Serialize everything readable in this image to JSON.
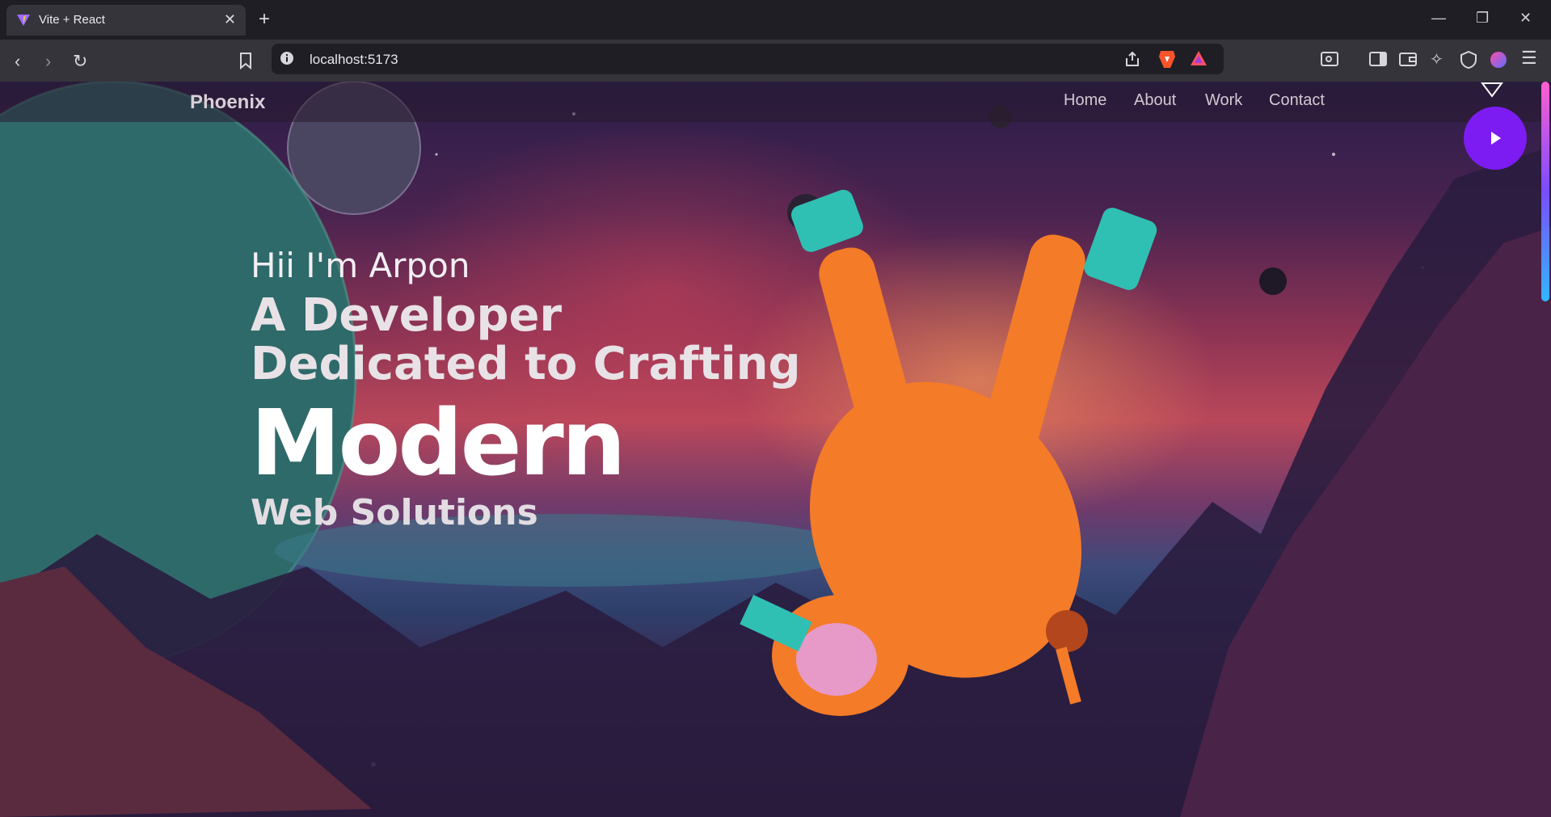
{
  "browser": {
    "tab_title": "Vite + React",
    "url": "localhost:5173"
  },
  "site": {
    "brand": "Phoenix",
    "nav": [
      {
        "label": "Home"
      },
      {
        "label": "About"
      },
      {
        "label": "Work"
      },
      {
        "label": "Contact"
      }
    ],
    "hero": {
      "greeting": "Hii I'm Arpon",
      "line2": "A Developer",
      "line3": "Dedicated to Crafting",
      "line4": "Modern",
      "line5": "Web Solutions"
    }
  },
  "icons": [
    "vite-favicon",
    "close-icon",
    "plus-icon",
    "minimize-icon",
    "restore-icon",
    "window-close-icon",
    "back-icon",
    "forward-icon",
    "reload-icon",
    "bookmark-icon",
    "info-icon",
    "share-icon",
    "brave-shields-icon",
    "brave-rewards-icon",
    "reader-icon",
    "sidebar-icon",
    "wallet-icon",
    "leo-icon",
    "vpn-icon",
    "profile-icon",
    "menu-icon",
    "play-icon",
    "cursor-icon"
  ],
  "colors": {
    "accent_play": "#7c1cf2",
    "browser_bg": "#1f1e24",
    "toolbar_bg": "#35343b"
  }
}
